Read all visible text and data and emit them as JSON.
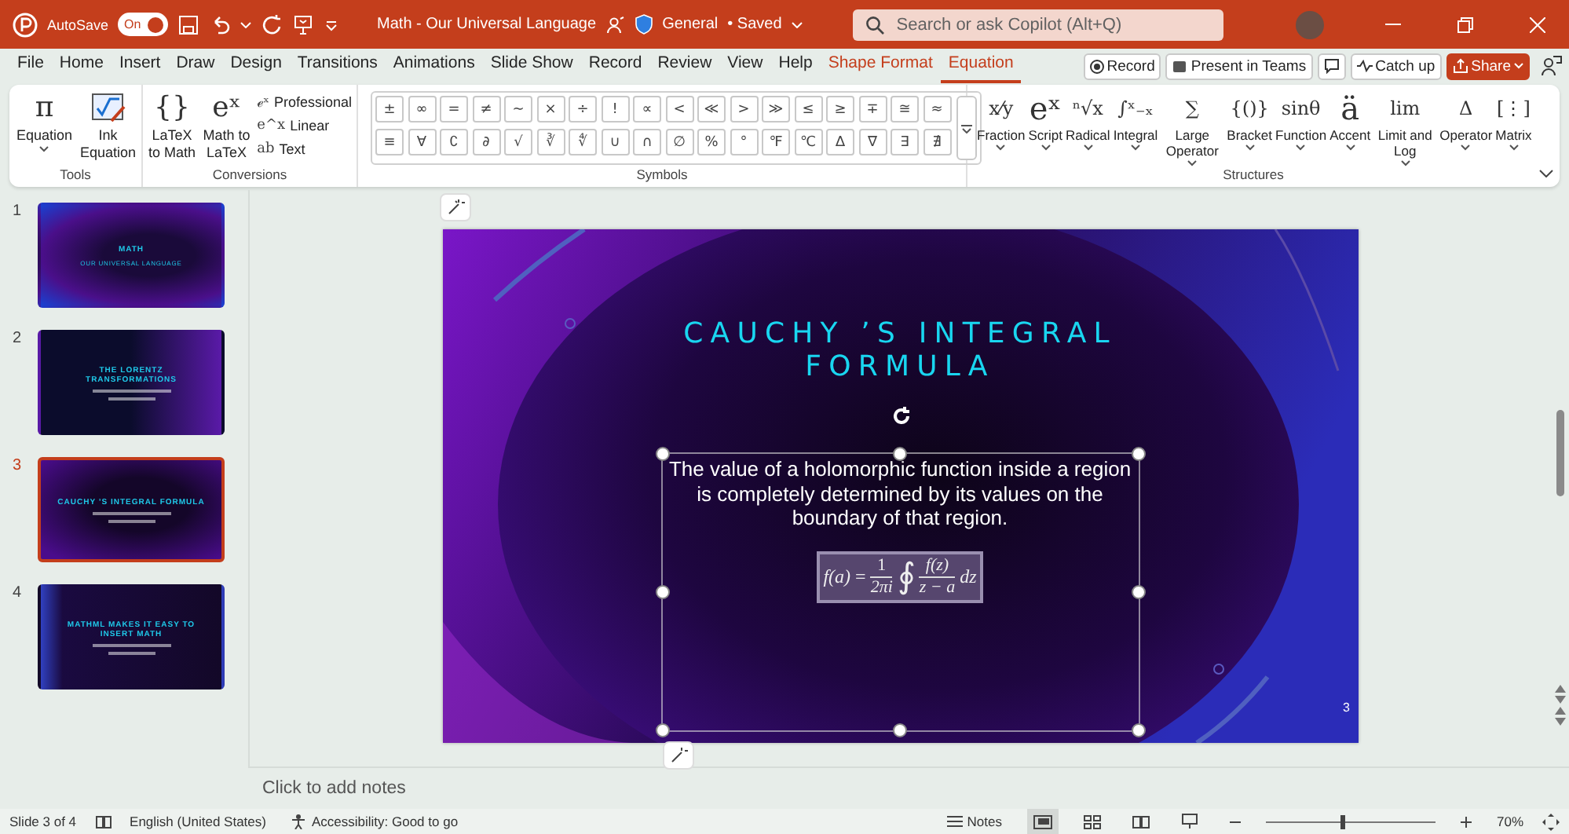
{
  "title_bar": {
    "autosave_label": "AutoSave",
    "autosave": {
      "label": "On",
      "on": true
    },
    "document_title": "Math - Our Universal Language",
    "sensitivity": "General",
    "save_state": "• Saved",
    "search": {
      "placeholder": "Search or ask Copilot (Alt+Q)"
    }
  },
  "tabs": [
    {
      "label": "File",
      "selected": false,
      "kind": "normal"
    },
    {
      "label": "Home",
      "selected": false,
      "kind": "normal"
    },
    {
      "label": "Insert",
      "selected": false,
      "kind": "normal"
    },
    {
      "label": "Draw",
      "selected": false,
      "kind": "normal"
    },
    {
      "label": "Design",
      "selected": false,
      "kind": "normal"
    },
    {
      "label": "Transitions",
      "selected": false,
      "kind": "normal"
    },
    {
      "label": "Animations",
      "selected": false,
      "kind": "normal"
    },
    {
      "label": "Slide Show",
      "selected": false,
      "kind": "normal"
    },
    {
      "label": "Record",
      "selected": false,
      "kind": "normal"
    },
    {
      "label": "Review",
      "selected": false,
      "kind": "normal"
    },
    {
      "label": "View",
      "selected": false,
      "kind": "normal"
    },
    {
      "label": "Help",
      "selected": false,
      "kind": "normal"
    },
    {
      "label": "Shape Format",
      "selected": false,
      "kind": "contextual"
    },
    {
      "label": "Equation",
      "selected": true,
      "kind": "contextual"
    }
  ],
  "tab_actions": {
    "record": "Record",
    "present": "Present in Teams",
    "catch_up": "Catch up",
    "share": "Share"
  },
  "ribbon": {
    "tools": {
      "label": "Tools",
      "equation_icon": "π",
      "equation": "Equation",
      "ink_equation": "Ink Equation"
    },
    "conversions": {
      "label": "Conversions",
      "latex_to_math_icon": "{}",
      "latex_to_math": "LaTeX to Math",
      "math_to_latex_icon": "eˣ",
      "math_to_latex": "Math to LaTeX",
      "options": [
        {
          "icon": "ℯˣ",
          "label": "Professional"
        },
        {
          "icon": "e^x",
          "label": "Linear"
        },
        {
          "icon": "ab",
          "label": "Text"
        }
      ]
    },
    "symbols": {
      "label": "Symbols",
      "rows": [
        [
          "±",
          "∞",
          "=",
          "≠",
          "~",
          "×",
          "÷",
          "!",
          "∝",
          "<",
          "≪",
          ">",
          "≫",
          "≤",
          "≥",
          "∓",
          "≅",
          "≈"
        ],
        [
          "≡",
          "∀",
          "∁",
          "∂",
          "√",
          "∛",
          "∜",
          "∪",
          "∩",
          "∅",
          "%",
          "°",
          "℉",
          "℃",
          "∆",
          "∇",
          "∃",
          "∄"
        ]
      ]
    },
    "structures": {
      "label": "Structures",
      "items": [
        {
          "icon": "x⁄y",
          "label": "Fraction"
        },
        {
          "icon": "eˣ",
          "label": "Script"
        },
        {
          "icon": "ⁿ√x",
          "label": "Radical"
        },
        {
          "icon": "∫ˣ₋ₓ",
          "label": "Integral"
        },
        {
          "icon": "∑",
          "label": "Large Operator"
        },
        {
          "icon": "{()}",
          "label": "Bracket"
        },
        {
          "icon": "sinθ",
          "label": "Function"
        },
        {
          "icon": "ä",
          "label": "Accent"
        },
        {
          "icon": "lim",
          "label": "Limit and Log"
        },
        {
          "icon": "Δ",
          "label": "Operator"
        },
        {
          "icon": "[⋮]",
          "label": "Matrix"
        }
      ]
    }
  },
  "slides_panel": [
    {
      "number": "1",
      "title": "MATH",
      "subtitle": "OUR UNIVERSAL LANGUAGE",
      "selected": false
    },
    {
      "number": "2",
      "title": "THE LORENTZ TRANSFORMATIONS",
      "selected": false
    },
    {
      "number": "3",
      "title": "CAUCHY ’S INTEGRAL FORMULA",
      "selected": true
    },
    {
      "number": "4",
      "title": "MATHML MAKES IT EASY TO INSERT MATH",
      "selected": false
    }
  ],
  "slide": {
    "title": "CAUCHY ’S INTEGRAL FORMULA",
    "body": "The value of a holomorphic function inside a region is completely determined by its values on the boundary of that region.",
    "equation": {
      "lhs": "f(a)",
      "equals": "=",
      "numerator": "1",
      "denominator": "2πi",
      "integral": "∮",
      "integrand_numerator": "f(z)",
      "integrand_denominator": "z − a",
      "differential": "dz"
    },
    "number": "3"
  },
  "notes": {
    "placeholder": "Click to add notes"
  },
  "status_bar": {
    "slide": "Slide 3 of 4",
    "language": "English (United States)",
    "accessibility": "Accessibility: Good to go",
    "notes": "Notes",
    "zoom": {
      "level": 0.45,
      "reading": "70%"
    }
  }
}
